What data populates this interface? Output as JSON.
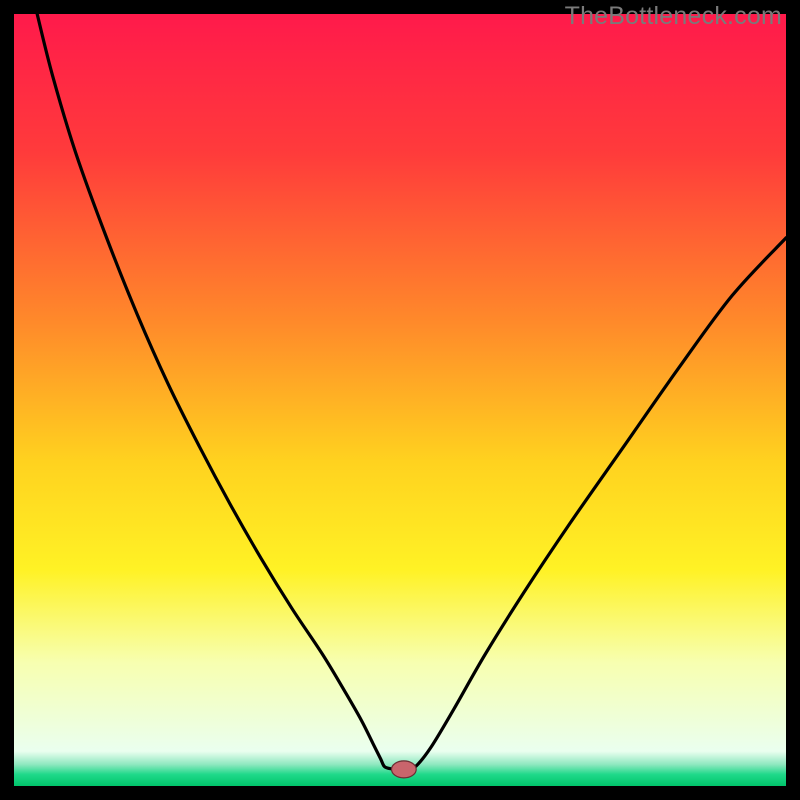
{
  "watermark": "TheBottleneck.com",
  "chart_data": {
    "type": "line",
    "title": "",
    "xlabel": "",
    "ylabel": "",
    "xlim": [
      0,
      100
    ],
    "ylim": [
      0,
      100
    ],
    "gradient_stops": [
      {
        "offset": 0.0,
        "color": "#ff1a4b"
      },
      {
        "offset": 0.18,
        "color": "#ff3b3b"
      },
      {
        "offset": 0.4,
        "color": "#ff8a2a"
      },
      {
        "offset": 0.58,
        "color": "#ffd21f"
      },
      {
        "offset": 0.72,
        "color": "#fff225"
      },
      {
        "offset": 0.84,
        "color": "#f7ffb0"
      },
      {
        "offset": 0.955,
        "color": "#eaffef"
      },
      {
        "offset": 0.972,
        "color": "#8fe8c0"
      },
      {
        "offset": 0.985,
        "color": "#1fd98a"
      },
      {
        "offset": 1.0,
        "color": "#00c46a"
      }
    ],
    "series": [
      {
        "name": "left-branch",
        "x": [
          3,
          5,
          8,
          12,
          16,
          20,
          24,
          28,
          32,
          36,
          40,
          43,
          45,
          46.5,
          47.5,
          48
        ],
        "y": [
          100,
          92,
          82,
          71,
          61,
          52,
          44,
          36.5,
          29.5,
          23,
          17,
          12,
          8.5,
          5.5,
          3.5,
          2.5
        ]
      },
      {
        "name": "valley-floor",
        "x": [
          48,
          49,
          50,
          51,
          52
        ],
        "y": [
          2.5,
          2.2,
          2.1,
          2.2,
          2.5
        ]
      },
      {
        "name": "right-branch",
        "x": [
          52,
          54,
          57,
          61,
          66,
          72,
          79,
          86,
          93,
          100
        ],
        "y": [
          2.5,
          5,
          10,
          17,
          25,
          34,
          44,
          54,
          63.5,
          71
        ]
      }
    ],
    "marker": {
      "x": 50.5,
      "y": 2.15,
      "rx": 1.6,
      "ry": 1.1,
      "fill": "#c9656c",
      "stroke": "#6b2e33"
    }
  }
}
